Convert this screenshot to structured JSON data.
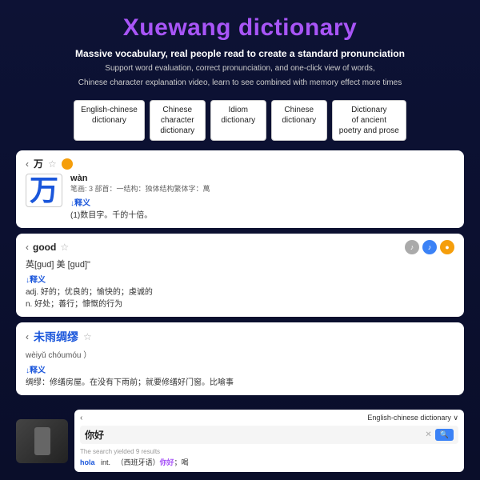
{
  "header": {
    "title": "Xuewang dictionary",
    "subtitle_bold": "Massive vocabulary, real people read to create a standard pronunciation",
    "subtitle1": "Support word evaluation, correct pronunciation, and one-click view of words,",
    "subtitle2": "Chinese character explanation video, learn to see combined with memory effect more times"
  },
  "tabs": [
    {
      "label": "English-chinese\ndictionary",
      "active": false
    },
    {
      "label": "Chinese\ncharacter\ndictionary",
      "active": false
    },
    {
      "label": "Idiom\ndictionary",
      "active": false
    },
    {
      "label": "Chinese\ndictionary",
      "active": false
    },
    {
      "label": "Dictionary\nof ancient\npoetry and prose",
      "active": false
    }
  ],
  "card1": {
    "back": "‹",
    "word": "万",
    "star": "☆",
    "tag": "●",
    "char_big": "万",
    "pinyin": "wàn",
    "strokes": "笔画: 3  部首：一结构：独体结构繁体字：萬",
    "section_label": "↓释义",
    "definition": "(1)数目字。千的十倍。"
  },
  "card2": {
    "back": "‹",
    "word": "good",
    "star": "☆",
    "icons": [
      "♪",
      "♪",
      "●"
    ],
    "phonetic": "英[ɡud]  美 [ɡud]\"",
    "section_label": "↓释义",
    "definition_adj": "adj. 好的；优良的；愉快的；虔诚的",
    "definition_n": "n. 好处；善行；慷慨的行为"
  },
  "card3": {
    "back": "‹",
    "idiom": "未雨绸缪",
    "star": "☆",
    "pinyin": "wèiyǔ chóumóu ）",
    "section_label": "↓释义",
    "definition": "绸缪：修缮房屋。在没有下雨前；就要修缮好门窗。比喻事"
  },
  "device": {
    "back": "‹",
    "dict_label": "English-chinese dictionary ∨",
    "search_text": "你好",
    "search_placeholder": "The search yielded 9 results",
    "result_entry": "hola",
    "result_pos": "int.",
    "result_detail": "（西班牙语）你好；喝"
  }
}
